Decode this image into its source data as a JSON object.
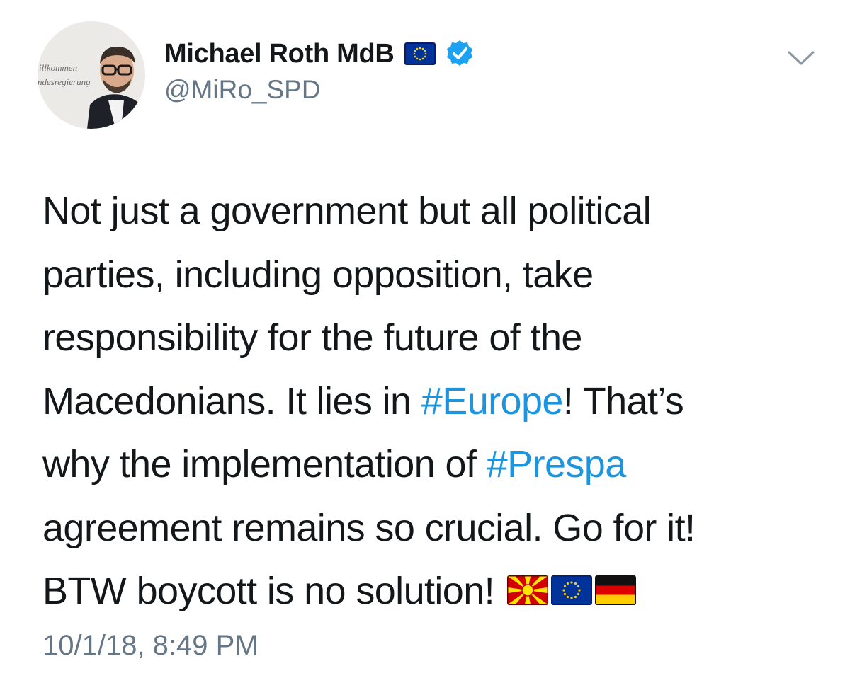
{
  "author": {
    "display_name": "Michael Roth MdB",
    "handle": "@MiRo_SPD",
    "verified": true,
    "avatar_background_text": [
      "illkommen",
      "ndesregierung"
    ],
    "name_emoji": "eu-flag-icon"
  },
  "tweet": {
    "lines": [
      {
        "parts": [
          {
            "text": "Not just a government but all political",
            "type": "text"
          }
        ]
      },
      {
        "parts": [
          {
            "text": "parties, including opposition, take",
            "type": "text"
          }
        ]
      },
      {
        "parts": [
          {
            "text": "responsibility for the future of the",
            "type": "text"
          }
        ]
      },
      {
        "parts": [
          {
            "text": "Macedonians. It lies in ",
            "type": "text"
          },
          {
            "text": "#Europe",
            "type": "hashtag"
          },
          {
            "text": "! That’s",
            "type": "text"
          }
        ]
      },
      {
        "parts": [
          {
            "text": "why the implementation of ",
            "type": "text"
          },
          {
            "text": "#Prespa",
            "type": "hashtag"
          }
        ]
      },
      {
        "parts": [
          {
            "text": "agreement remains so crucial. Go for it!",
            "type": "text"
          }
        ]
      },
      {
        "parts": [
          {
            "text": "BTW boycott is no solution! ",
            "type": "text"
          }
        ]
      }
    ],
    "trailing_emojis": [
      "macedonia-flag-icon",
      "eu-flag-icon",
      "germany-flag-icon"
    ],
    "timestamp": "10/1/18, 8:49 PM"
  },
  "colors": {
    "hashtag": "#1b95e0",
    "secondary_text": "#657786",
    "verified_badge": "#1da1f2",
    "eu_blue": "#003399",
    "eu_gold": "#ffcc00"
  },
  "icons": {
    "menu": "chevron-down-icon",
    "verified": "verified-badge-icon"
  }
}
